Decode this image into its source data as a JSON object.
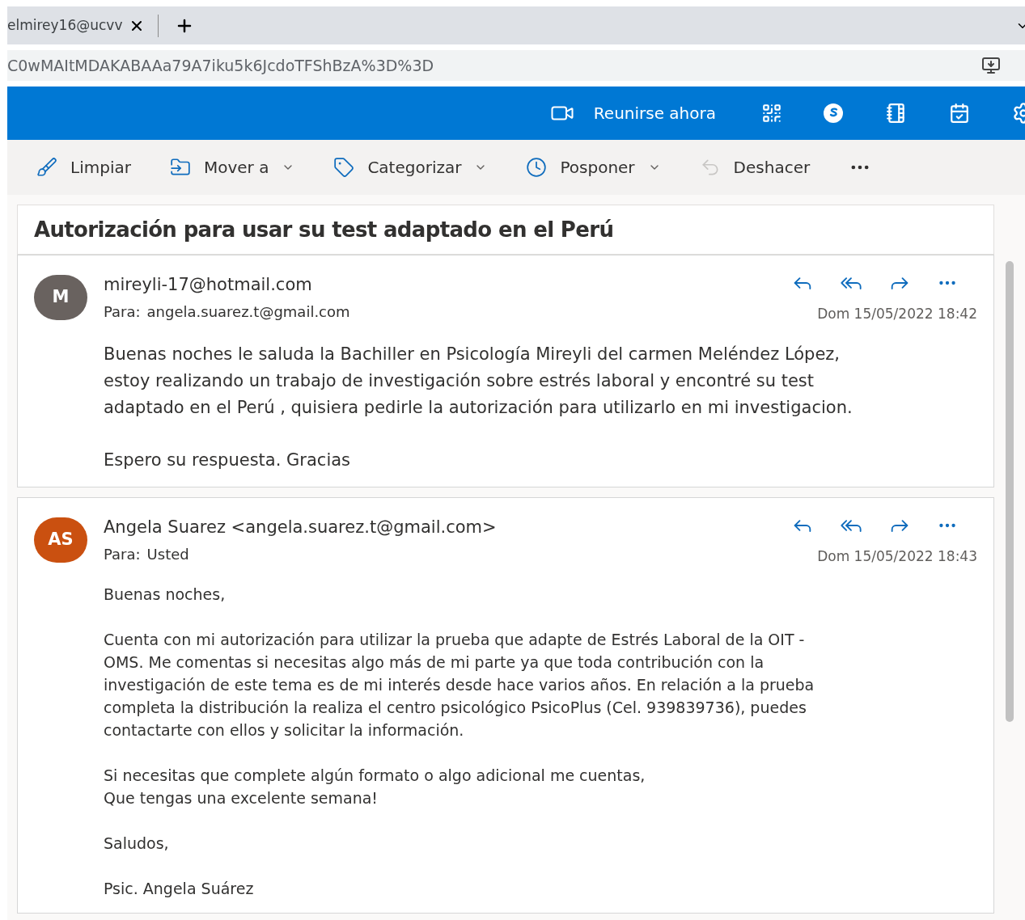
{
  "browser": {
    "tab": {
      "title": "elmirey16@ucvv"
    },
    "address": "C0wMAItMDAKABAAa79A7iku5k6JcdoTFShBzA%3D%3D"
  },
  "app_bar": {
    "meet_now": "Reunirse ahora"
  },
  "toolbar": [
    {
      "label": "Limpiar",
      "kind": "sweep",
      "dropdown": false,
      "disabled": false
    },
    {
      "label": "Mover a",
      "kind": "move",
      "dropdown": true,
      "disabled": false
    },
    {
      "label": "Categorizar",
      "kind": "tag",
      "dropdown": true,
      "disabled": false
    },
    {
      "label": "Posponer",
      "kind": "clock",
      "dropdown": true,
      "disabled": false
    },
    {
      "label": "Deshacer",
      "kind": "undo",
      "dropdown": false,
      "disabled": true
    }
  ],
  "subject": "Autorización para usar su test adaptado en el Perú",
  "messages": [
    {
      "initials": "M",
      "color": "#69625f",
      "from": "mireyli-17@hotmail.com",
      "to_label": "Para:",
      "to": "angela.suarez.t@gmail.com",
      "date": "Dom 15/05/2022 18:42",
      "paragraphs": [
        "Buenas noches le saluda la Bachiller en Psicología Mireyli del carmen Meléndez López,\nestoy realizando un trabajo de investigación sobre estrés laboral y encontré su test\nadaptado en el Perú , quisiera pedirle la autorización para utilizarlo en mi investigacion.",
        "Espero su respuesta. Gracias"
      ]
    },
    {
      "initials": "AS",
      "color": "#ca5010",
      "from": "Angela Suarez <angela.suarez.t@gmail.com>",
      "to_label": "Para:",
      "to": "Usted",
      "date": "Dom 15/05/2022 18:43",
      "paragraphs": [
        "Buenas noches,",
        "Cuenta con mi autorización para utilizar la prueba que adapte de Estrés Laboral de la OIT -\nOMS. Me comentas si necesitas algo más de mi parte ya que toda contribución con la\ninvestigación de este tema es de mi interés desde hace varios años. En relación a la prueba\ncompleta la distribución la realiza el centro psicológico PsicoPlus (Cel. 939839736), puedes\ncontactarte con ellos y solicitar la información.",
        "Si necesitas que complete algún formato o algo adicional me cuentas,\nQue tengas una excelente semana!",
        "Saludos,",
        "Psic. Angela Suárez"
      ]
    }
  ]
}
